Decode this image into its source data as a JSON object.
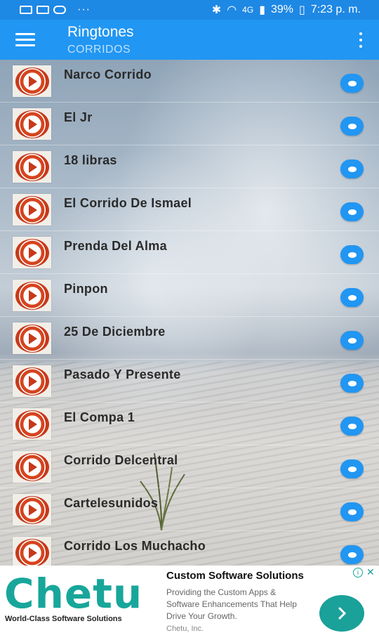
{
  "status_bar": {
    "battery": "39%",
    "time": "7:23 p. m.",
    "network": "4G"
  },
  "appbar": {
    "title": "Ringtones",
    "subtitle": "CORRIDOS"
  },
  "ringtones": [
    "Narco Corrido",
    "El Jr",
    "18 libras",
    "El Corrido De Ismael",
    "Prenda Del Alma",
    "Pinpon",
    "25 De Diciembre",
    "Pasado Y Presente",
    "El Compa 1",
    "Corrido Delcentral",
    "Cartelesunidos",
    "Corrido Los Muchacho"
  ],
  "ad": {
    "logo": "Chetu",
    "tagline": "World-Class Software Solutions",
    "title": "Custom Software Solutions",
    "description": "Providing the Custom Apps & Software Enhancements That Help Drive Your Growth.",
    "advertiser": "Chetu, Inc.",
    "accent_color": "#1aa19a"
  },
  "colors": {
    "appbar": "#2196f3",
    "statusbar": "#1e88e5",
    "toggle": "#2196f3",
    "play_icon": "#c7391a"
  }
}
